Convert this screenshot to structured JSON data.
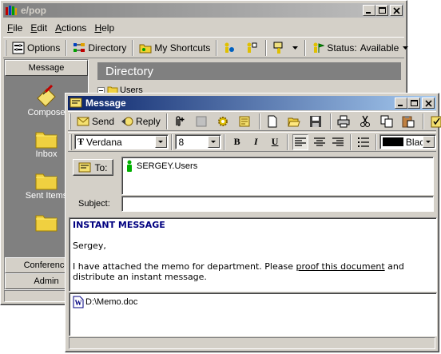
{
  "back": {
    "title": "e/pop",
    "menu": [
      "File",
      "Edit",
      "Actions",
      "Help"
    ],
    "toolbar": {
      "options": "Options",
      "directory": "Directory",
      "shortcuts": "My Shortcuts",
      "status_label": "Status:",
      "status_value": "Available"
    },
    "nav": {
      "header": "Message",
      "items": [
        "Compose",
        "Inbox",
        "Sent Items",
        ""
      ],
      "bottom": [
        "Conference",
        "Admin"
      ]
    },
    "directory": {
      "title": "Directory",
      "tree_item": "Users"
    }
  },
  "msg": {
    "title": "Message",
    "toolbar": {
      "send": "Send",
      "reply": "Reply"
    },
    "format": {
      "font": "Verdana",
      "size": "8",
      "bold": "B",
      "italic": "I",
      "underline": "U",
      "color": "Black"
    },
    "to_label": "To:",
    "recipient": "SERGEY.Users",
    "subject_label": "Subject:",
    "subject_value": "",
    "body": {
      "heading": "INSTANT MESSAGE",
      "greeting": "Sergey,",
      "line_before": "I have attached the memo for department. Please ",
      "link": "proof this document",
      "line_after": " and distribute an instant message."
    },
    "attachment": "D:\\Memo.doc"
  },
  "colors": {
    "active_title": "#0a246a",
    "inactive_title": "#808080",
    "heading": "#000080",
    "face": "#d4d0c8"
  }
}
